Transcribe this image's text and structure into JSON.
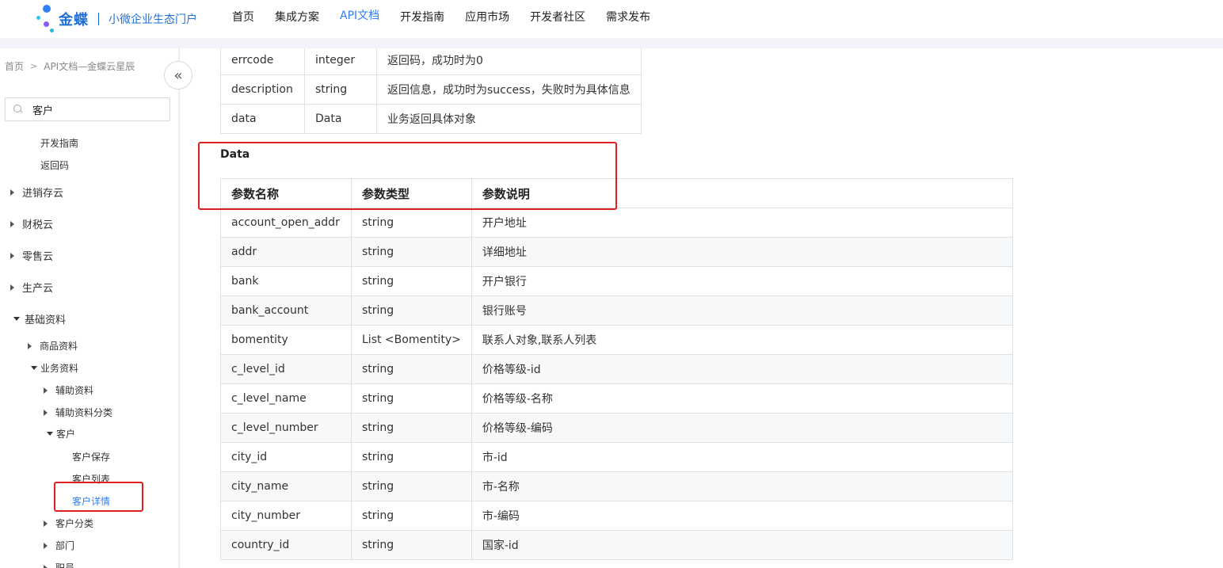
{
  "logo": {
    "brand": "金蝶",
    "subtitle": "小微企业生态门户"
  },
  "nav": {
    "items": [
      {
        "label": "首页"
      },
      {
        "label": "集成方案"
      },
      {
        "label": "API文档"
      },
      {
        "label": "开发指南"
      },
      {
        "label": "应用市场"
      },
      {
        "label": "开发者社区"
      },
      {
        "label": "需求发布"
      }
    ],
    "active": "API文档"
  },
  "sidebar": {
    "breadcrumb": {
      "home": "首页",
      "current": "API文档—金蝶云星辰"
    },
    "search_value": "客户",
    "tree": [
      {
        "label": "开发指南"
      },
      {
        "label": "返回码"
      },
      {
        "label": "进销存云"
      },
      {
        "label": "财税云"
      },
      {
        "label": "零售云"
      },
      {
        "label": "生产云"
      },
      {
        "label": "基础资料"
      },
      {
        "label": "商品资料"
      },
      {
        "label": "业务资料"
      },
      {
        "label": "辅助资料"
      },
      {
        "label": "辅助资料分类"
      },
      {
        "label": "客户"
      },
      {
        "label": "客户保存"
      },
      {
        "label": "客户列表"
      },
      {
        "label": "客户详情"
      },
      {
        "label": "客户分类"
      },
      {
        "label": "部门"
      },
      {
        "label": "职员"
      }
    ]
  },
  "response_table": {
    "rows": [
      [
        "errcode",
        "integer",
        "返回码，成功时为0"
      ],
      [
        "description",
        "string",
        "返回信息，成功时为success，失败时为具体信息"
      ],
      [
        "data",
        "Data",
        "业务返回具体对象"
      ]
    ]
  },
  "data_section": {
    "heading": "Data",
    "headers": [
      "参数名称",
      "参数类型",
      "参数说明"
    ],
    "rows": [
      [
        "account_open_addr",
        "string",
        "开户地址"
      ],
      [
        "addr",
        "string",
        "详细地址"
      ],
      [
        "bank",
        "string",
        "开户银行"
      ],
      [
        "bank_account",
        "string",
        "银行账号"
      ],
      [
        "bomentity",
        "List <Bomentity>",
        "联系人对象,联系人列表"
      ],
      [
        "c_level_id",
        "string",
        "价格等级-id"
      ],
      [
        "c_level_name",
        "string",
        "价格等级-名称"
      ],
      [
        "c_level_number",
        "string",
        "价格等级-编码"
      ],
      [
        "city_id",
        "string",
        "市-id"
      ],
      [
        "city_name",
        "string",
        "市-名称"
      ],
      [
        "city_number",
        "string",
        "市-编码"
      ],
      [
        "country_id",
        "string",
        "国家-id"
      ]
    ]
  },
  "colors": {
    "accent": "#2f7ff5",
    "highlight_box": "#e02020",
    "brand": "#1f6fd8"
  }
}
